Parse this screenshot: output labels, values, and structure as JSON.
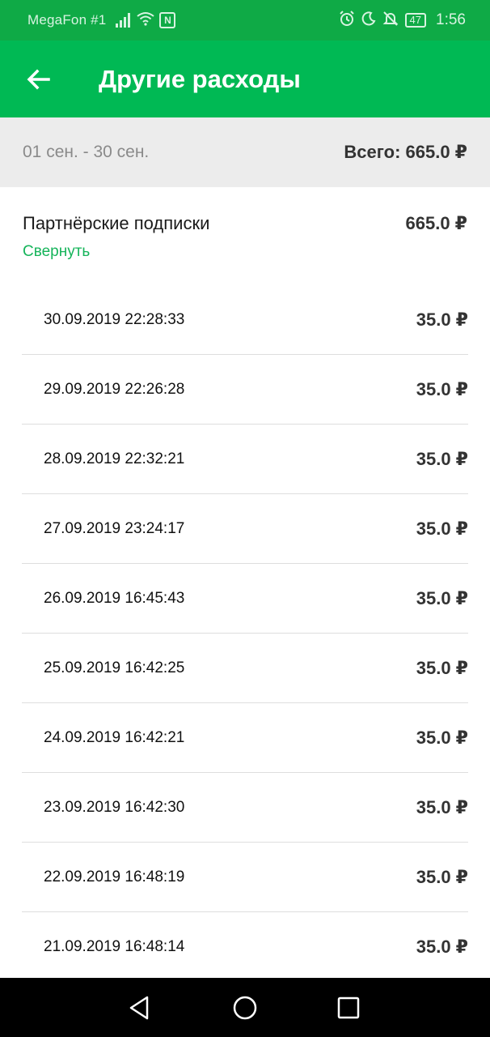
{
  "status_bar": {
    "carrier": "MegaFon #1",
    "battery": "47",
    "time": "1:56",
    "icons": [
      "signal-icon",
      "wifi-icon",
      "nfc-icon",
      "alarm-icon",
      "moon-icon",
      "bell-off-icon",
      "battery-icon"
    ]
  },
  "app_bar": {
    "title": "Другие расходы",
    "back_icon": "arrow-left-icon"
  },
  "period": {
    "range": "01 сен. - 30 сен.",
    "total": "Всего: 665.0 ₽"
  },
  "group": {
    "name": "Партнёрские подписки",
    "sum": "665.0 ₽",
    "collapse_label": "Свернуть"
  },
  "transactions": [
    {
      "datetime": "30.09.2019 22:28:33",
      "amount": "35.0 ₽"
    },
    {
      "datetime": "29.09.2019 22:26:28",
      "amount": "35.0 ₽"
    },
    {
      "datetime": "28.09.2019 22:32:21",
      "amount": "35.0 ₽"
    },
    {
      "datetime": "27.09.2019 23:24:17",
      "amount": "35.0 ₽"
    },
    {
      "datetime": "26.09.2019 16:45:43",
      "amount": "35.0 ₽"
    },
    {
      "datetime": "25.09.2019 16:42:25",
      "amount": "35.0 ₽"
    },
    {
      "datetime": "24.09.2019 16:42:21",
      "amount": "35.0 ₽"
    },
    {
      "datetime": "23.09.2019 16:42:30",
      "amount": "35.0 ₽"
    },
    {
      "datetime": "22.09.2019 16:48:19",
      "amount": "35.0 ₽"
    },
    {
      "datetime": "21.09.2019 16:48:14",
      "amount": "35.0 ₽"
    }
  ],
  "nav_bar": {
    "icons": [
      "back-triangle-icon",
      "home-circle-icon",
      "recents-square-icon"
    ]
  },
  "colors": {
    "status_bar": "#0faa46",
    "app_bar": "#00b954",
    "accent_link": "#15b45a",
    "period_bg": "#ececec"
  }
}
